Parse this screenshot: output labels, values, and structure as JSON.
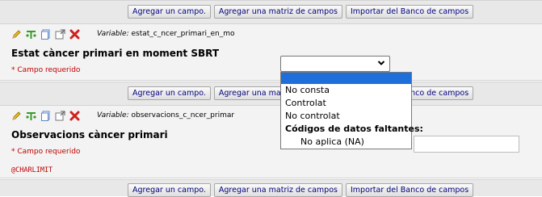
{
  "toolbar": {
    "add_field": "Agregar un campo.",
    "add_matrix": "Agregar una matriz de campos",
    "import_bank": "Importar del Banco de campos"
  },
  "fields": [
    {
      "variable_prefix": "Variable:",
      "variable_name": "estat_c_ncer_primari_en_mo",
      "label": "Estat càncer primari en moment SBRT",
      "required": "* Campo requerido"
    },
    {
      "variable_prefix": "Variable:",
      "variable_name": "observacions_c_ncer_primar",
      "label": "Observacions càncer primari",
      "required": "* Campo requerido",
      "annotation": "@CHARLIMIT"
    }
  ],
  "dropdown": {
    "selected": "",
    "options": [
      "No consta",
      "Controlat",
      "No controlat"
    ],
    "group_label": "Códigos de datos faltantes:",
    "group_options": [
      "No aplica (NA)"
    ]
  },
  "icons": [
    "pencil-icon",
    "branching-icon",
    "copy-icon",
    "move-icon",
    "delete-icon",
    "chevron-down-icon"
  ],
  "colors": {
    "required": "#c00000",
    "selected_option": "#1e6fd9",
    "button_text": "#00007a"
  }
}
